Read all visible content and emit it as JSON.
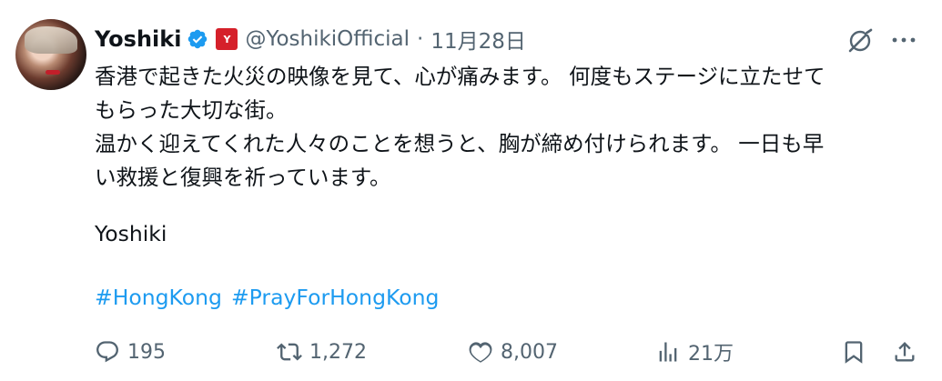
{
  "author": {
    "name": "Yoshiki",
    "handle": "@YoshikiOfficial",
    "separator": "·",
    "date": "11月28日",
    "affiliate_badge_text": "Y",
    "verified": true
  },
  "tweet": {
    "lines": [
      "香港で起きた火災の映像を見て、心が痛みます。 何度もステージに立たせて",
      "もらった大切な街。",
      "温かく迎えてくれた人々のことを想うと、胸が締め付けられます。 一日も早",
      "い救援と復興を祈っています。"
    ],
    "signature": "Yoshiki",
    "hashtags": [
      "#HongKong",
      "#PrayForHongKong"
    ]
  },
  "actions": {
    "reply_count": "195",
    "retweet_count": "1,272",
    "like_count": "8,007",
    "views_count": "21万"
  },
  "icons": {
    "verified": "verified-badge-icon",
    "grok": "grok-icon",
    "more": "more-icon",
    "reply": "reply-icon",
    "retweet": "retweet-icon",
    "like": "heart-icon",
    "views": "views-icon",
    "bookmark": "bookmark-icon",
    "share": "share-icon"
  },
  "colors": {
    "text": "#0f1419",
    "secondary": "#536471",
    "link": "#1d9bf0",
    "verified": "#1d9bf0",
    "affiliate_badge": "#d5202a"
  }
}
